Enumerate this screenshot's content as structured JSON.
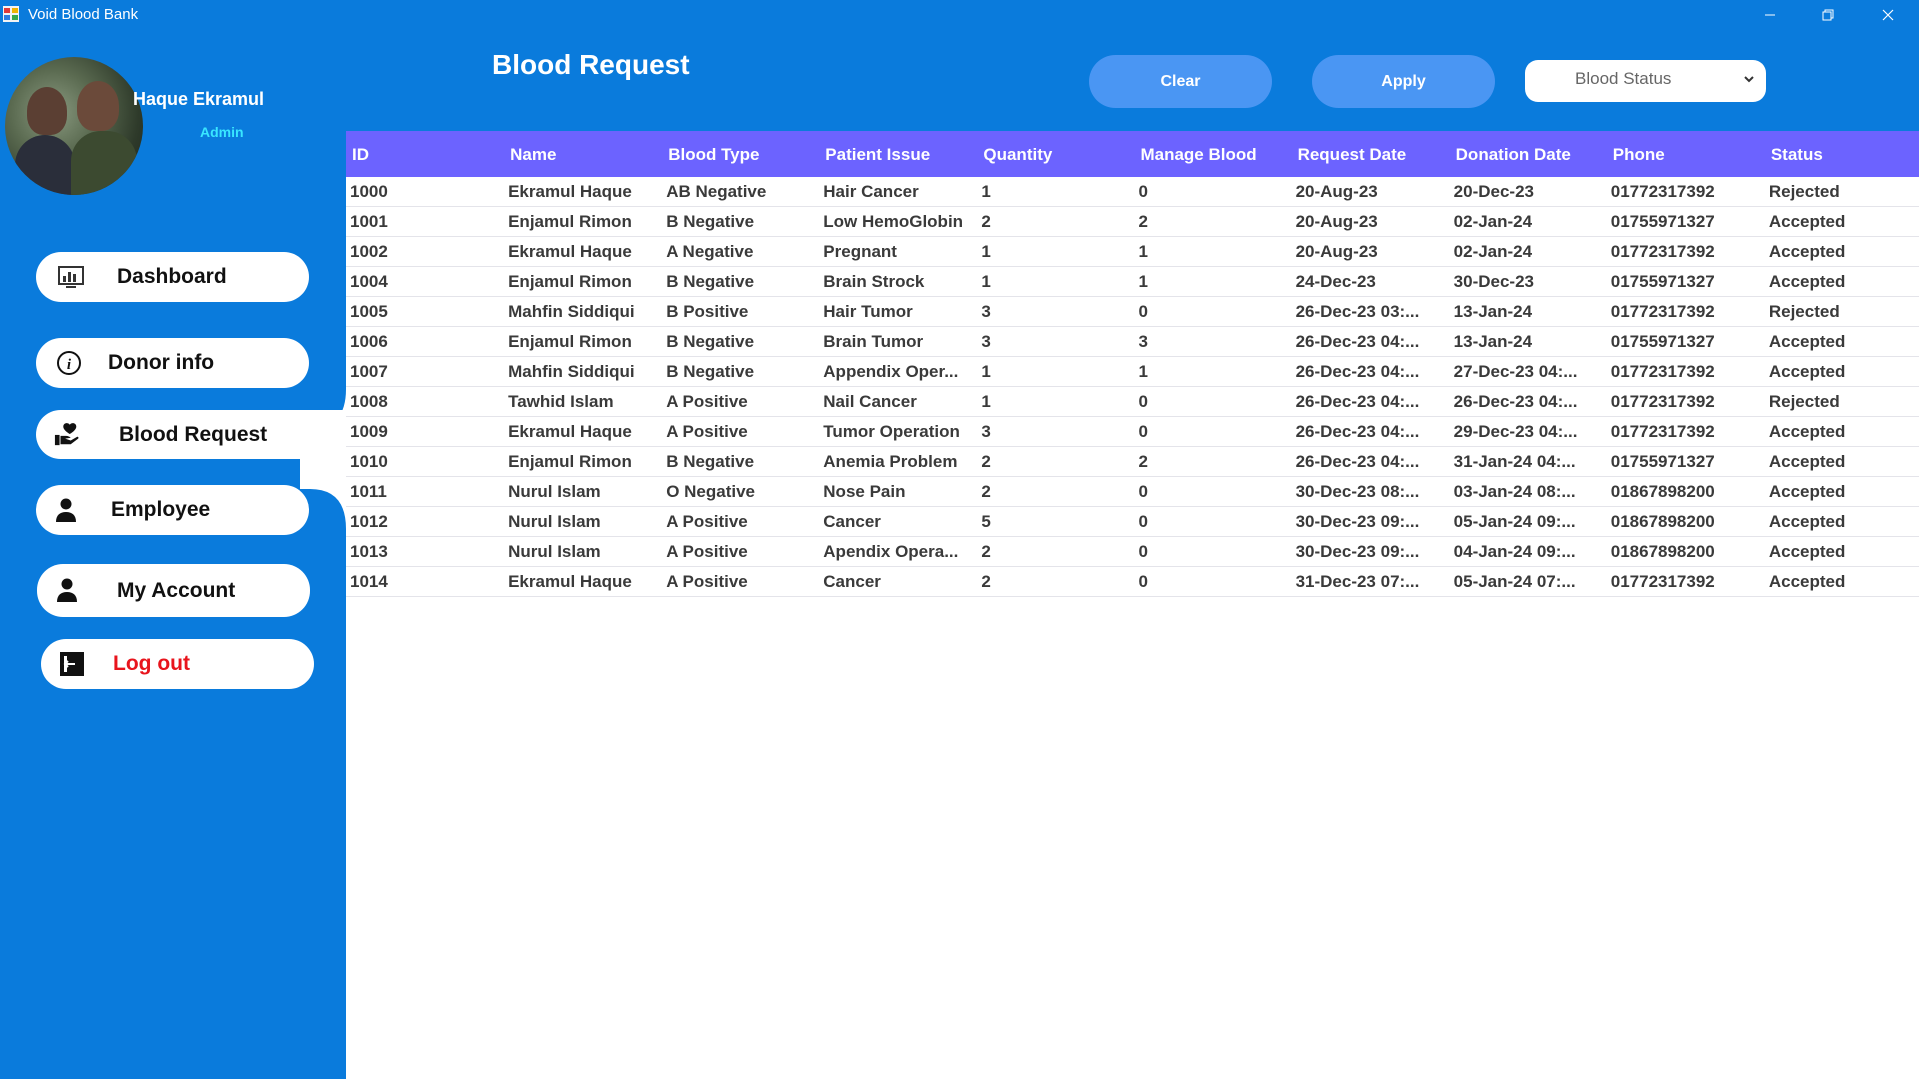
{
  "window": {
    "title": "Void Blood Bank"
  },
  "user": {
    "name": "Haque Ekramul",
    "role": "Admin"
  },
  "nav": {
    "dashboard": "Dashboard",
    "donor_info": "Donor info",
    "blood_request": "Blood Request",
    "employee": "Employee",
    "my_account": "My Account",
    "logout": "Log out"
  },
  "page": {
    "title": "Blood Request"
  },
  "filters": {
    "clear": "Clear",
    "apply": "Apply",
    "status_placeholder": "Blood Status"
  },
  "table": {
    "headers": [
      "ID",
      "Name",
      "Blood Type",
      "Patient Issue",
      "Quantity",
      "Manage Blood",
      "Request Date",
      "Donation Date",
      "Phone",
      "Status"
    ],
    "rows": [
      [
        "1000",
        "Ekramul Haque",
        "AB Negative",
        "Hair Cancer",
        "1",
        "0",
        "20-Aug-23",
        "20-Dec-23",
        "01772317392",
        "Rejected"
      ],
      [
        "1001",
        "Enjamul Rimon",
        "B Negative",
        "Low HemoGlobin",
        "2",
        "2",
        "20-Aug-23",
        "02-Jan-24",
        "01755971327",
        "Accepted"
      ],
      [
        "1002",
        "Ekramul Haque",
        "A Negative",
        "Pregnant",
        "1",
        "1",
        "20-Aug-23",
        "02-Jan-24",
        "01772317392",
        "Accepted"
      ],
      [
        "1004",
        "Enjamul Rimon",
        "B Negative",
        "Brain Strock",
        "1",
        "1",
        "24-Dec-23",
        "30-Dec-23",
        "01755971327",
        "Accepted"
      ],
      [
        "1005",
        "Mahfin Siddiqui",
        "B Positive",
        "Hair Tumor",
        "3",
        "0",
        "26-Dec-23 03:...",
        "13-Jan-24",
        "01772317392",
        "Rejected"
      ],
      [
        "1006",
        "Enjamul Rimon",
        "B Negative",
        "Brain Tumor",
        "3",
        "3",
        "26-Dec-23 04:...",
        "13-Jan-24",
        "01755971327",
        "Accepted"
      ],
      [
        "1007",
        "Mahfin Siddiqui",
        "B Negative",
        "Appendix Oper...",
        "1",
        "1",
        "26-Dec-23 04:...",
        "27-Dec-23 04:...",
        "01772317392",
        "Accepted"
      ],
      [
        "1008",
        "Tawhid Islam",
        "A Positive",
        "Nail Cancer",
        "1",
        "0",
        "26-Dec-23 04:...",
        "26-Dec-23 04:...",
        "01772317392",
        "Rejected"
      ],
      [
        "1009",
        "Ekramul Haque",
        "A Positive",
        "Tumor Operation",
        "3",
        "0",
        "26-Dec-23 04:...",
        "29-Dec-23 04:...",
        "01772317392",
        "Accepted"
      ],
      [
        "1010",
        "Enjamul Rimon",
        "B Negative",
        "Anemia Problem",
        "2",
        "2",
        "26-Dec-23 04:...",
        "31-Jan-24 04:...",
        "01755971327",
        "Accepted"
      ],
      [
        "1011",
        "Nurul Islam",
        "O Negative",
        "Nose Pain",
        "2",
        "0",
        "30-Dec-23 08:...",
        "03-Jan-24 08:...",
        "01867898200",
        "Accepted"
      ],
      [
        "1012",
        "Nurul Islam",
        "A Positive",
        "Cancer",
        "5",
        "0",
        "30-Dec-23 09:...",
        "05-Jan-24 09:...",
        "01867898200",
        "Accepted"
      ],
      [
        "1013",
        "Nurul Islam",
        "A Positive",
        "Apendix Opera...",
        "2",
        "0",
        "30-Dec-23 09:...",
        "04-Jan-24 09:...",
        "01867898200",
        "Accepted"
      ],
      [
        "1014",
        "Ekramul Haque",
        "A Positive",
        "Cancer",
        "2",
        "0",
        "31-Dec-23 07:...",
        "05-Jan-24 07:...",
        "01772317392",
        "Accepted"
      ]
    ]
  },
  "colors": {
    "sidebar_bg": "#0a7bdc",
    "header_row_bg": "#6c63ff",
    "pill_bg": "#4a96f3",
    "logout_text": "#e8141c",
    "role_text": "#39e6ff"
  }
}
